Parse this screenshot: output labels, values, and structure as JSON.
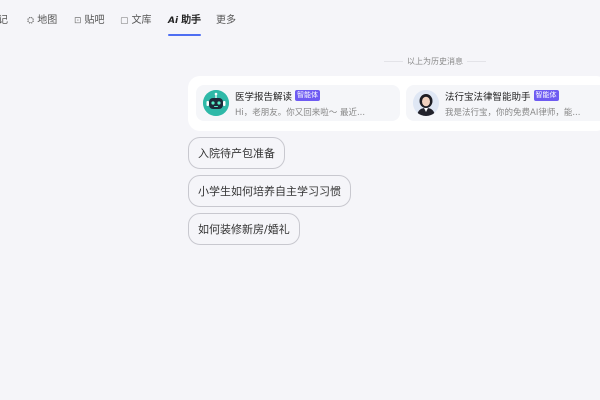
{
  "nav": {
    "items": [
      {
        "icon": "note-icon",
        "glyph": "",
        "label": "笔记"
      },
      {
        "icon": "map-icon",
        "glyph": "⛭",
        "label": "地图"
      },
      {
        "icon": "tieba-icon",
        "glyph": "⊡",
        "label": "贴吧"
      },
      {
        "icon": "library-icon",
        "glyph": "▢",
        "label": "文库"
      },
      {
        "icon": "ai-icon",
        "glyph": "Ai",
        "label": "助手"
      },
      {
        "icon": "",
        "glyph": "",
        "label": "更多"
      }
    ],
    "active_index": 4
  },
  "history_label": "以上为历史消息",
  "agents": [
    {
      "name": "医学报告解读",
      "badge": "智能体",
      "desc": "Hi，老朋友。你又回来啦～ 最近...",
      "avatar": "robot-avatar"
    },
    {
      "name": "法行宝法律智能助手",
      "badge": "智能体",
      "desc": "我是法行宝，你的免费AI律师，能...",
      "avatar": "lawyer-avatar"
    }
  ],
  "suggestions": [
    "入院待产包准备",
    "小学生如何培养自主学习习惯",
    "如何装修新房/婚礼"
  ],
  "colors": {
    "accent": "#4e6ef2",
    "badge": "#6e5bf2",
    "background": "#f5f5f9"
  }
}
